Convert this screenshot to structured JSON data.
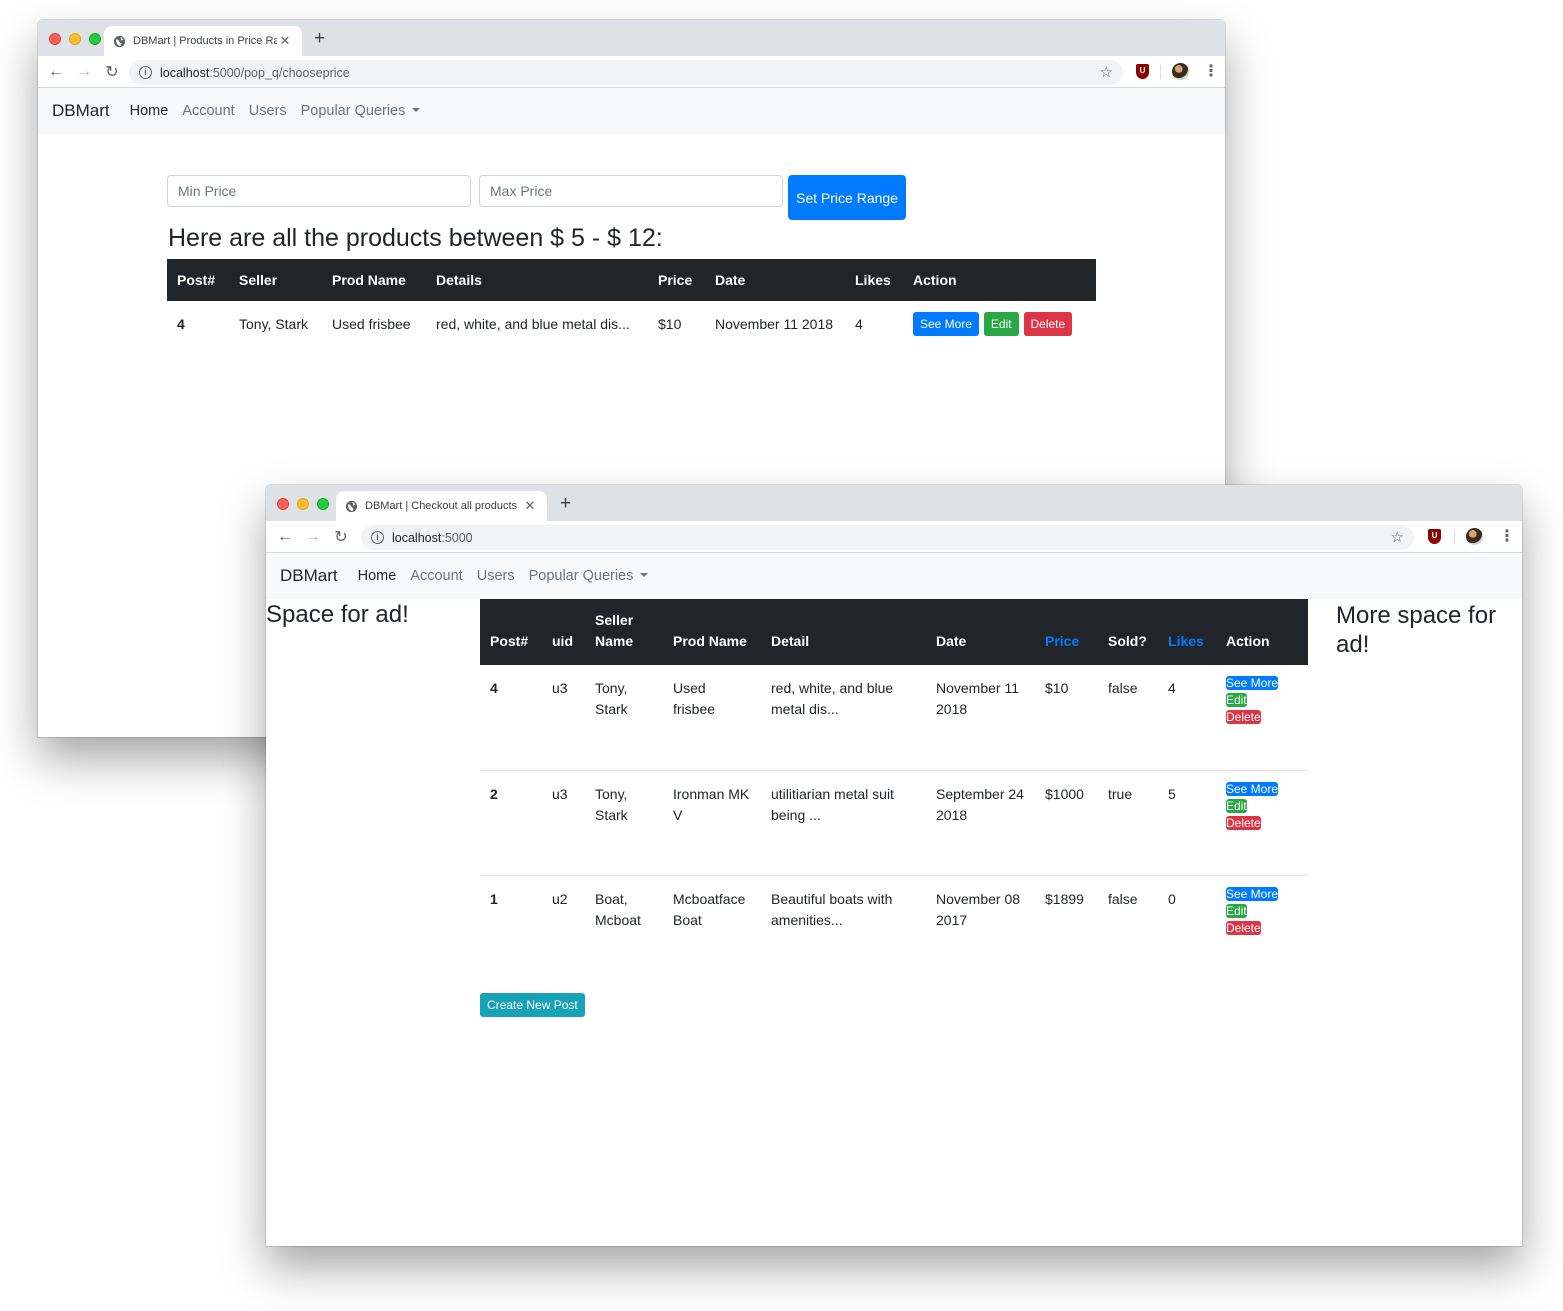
{
  "window1": {
    "tab_title": "DBMart | Products in Price Range",
    "url_host": "localhost",
    "url_path": ":5000/pop_q/chooseprice",
    "navbar": {
      "brand": "DBMart",
      "items": [
        "Home",
        "Account",
        "Users"
      ],
      "dropdown": "Popular Queries"
    },
    "form": {
      "min_placeholder": "Min Price",
      "max_placeholder": "Max Price",
      "submit_label": "Set Price Range"
    },
    "heading": "Here are all the products between $ 5 - $ 12:",
    "table": {
      "columns": [
        "Post#",
        "Seller",
        "Prod Name",
        "Details",
        "Price",
        "Date",
        "Likes",
        "Action"
      ],
      "rows": [
        {
          "post": "4",
          "seller": "Tony, Stark",
          "prod_name": "Used frisbee",
          "details": "red, white, and blue metal dis...",
          "price": "$10",
          "date": "November 11 2018",
          "likes": "4"
        }
      ],
      "actions": {
        "see_more": "See More",
        "edit": "Edit",
        "delete": "Delete"
      }
    }
  },
  "window2": {
    "tab_title": "DBMart | Checkout all products",
    "url_host": "localhost",
    "url_path": ":5000",
    "navbar": {
      "brand": "DBMart",
      "items": [
        "Home",
        "Account",
        "Users"
      ],
      "dropdown": "Popular Queries"
    },
    "ad_left": "Space for ad!",
    "ad_right": "More space for ad!",
    "table": {
      "columns": {
        "post": "Post#",
        "uid": "uid",
        "seller_line1": "Seller",
        "seller_line2": "Name",
        "prod_name": "Prod Name",
        "detail": "Detail",
        "date": "Date",
        "price": "Price",
        "sold": "Sold?",
        "likes": "Likes",
        "action": "Action"
      },
      "rows": [
        {
          "post": "4",
          "uid": "u3",
          "seller": "Tony, Stark",
          "prod_name": "Used frisbee",
          "detail": "red, white, and blue metal dis...",
          "date": "November 11 2018",
          "price": "$10",
          "sold": "false",
          "likes": "4"
        },
        {
          "post": "2",
          "uid": "u3",
          "seller": "Tony, Stark",
          "prod_name": "Ironman MK V",
          "detail": "utilitiarian metal suit being ...",
          "date": "September 24 2018",
          "price": "$1000",
          "sold": "true",
          "likes": "5"
        },
        {
          "post": "1",
          "uid": "u2",
          "seller": "Boat, Mcboat",
          "prod_name": "Mcboatface Boat",
          "detail": "Beautiful boats with amenities...",
          "date": "November 08 2017",
          "price": "$1899",
          "sold": "false",
          "likes": "0"
        }
      ],
      "actions": {
        "see_more": "See More",
        "edit": "Edit",
        "delete": "Delete"
      }
    },
    "create_button": "Create New Post"
  },
  "colors": {
    "primary": "#007bff",
    "success": "#28a745",
    "danger": "#dc3545",
    "info": "#17a2b8",
    "dark": "#212529"
  }
}
